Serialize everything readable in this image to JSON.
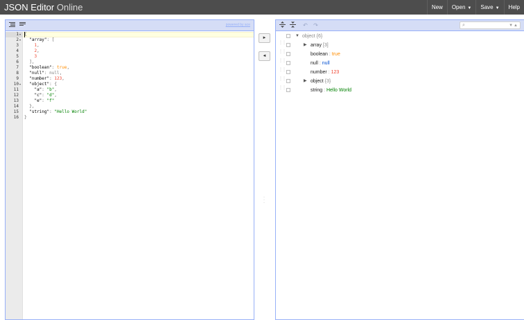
{
  "header": {
    "logo_bold": "JSON Editor",
    "logo_light": "Online",
    "menu": [
      {
        "label": "New",
        "has_caret": false
      },
      {
        "label": "Open",
        "has_caret": true
      },
      {
        "label": "Save",
        "has_caret": true
      },
      {
        "label": "Help",
        "has_caret": false
      }
    ]
  },
  "code_editor": {
    "powered_by": "powered by ace",
    "toolbar_buttons": [
      "format-icon",
      "compact-icon"
    ],
    "line_numbers": [
      "1",
      "2",
      "3",
      "4",
      "5",
      "6",
      "7",
      "8",
      "9",
      "10",
      "11",
      "12",
      "13",
      "14",
      "15",
      "16"
    ],
    "folds": [
      "1",
      "2",
      "10"
    ]
  },
  "tree_editor": {
    "toolbar_buttons": [
      "expand-all-icon",
      "collapse-all-icon",
      "undo-icon",
      "redo-icon"
    ],
    "root": {
      "type": "object",
      "count": "{6}"
    },
    "rows": [
      {
        "key": "array",
        "kind": "collapsed",
        "count": "[3]"
      },
      {
        "key": "boolean",
        "kind": "value",
        "value": "true",
        "vclass": "v-bool"
      },
      {
        "key": "null",
        "kind": "value",
        "value": "null",
        "vclass": "v-null"
      },
      {
        "key": "number",
        "kind": "value",
        "value": "123",
        "vclass": "v-num"
      },
      {
        "key": "object",
        "kind": "collapsed",
        "count": "{3}"
      },
      {
        "key": "string",
        "kind": "value",
        "value": "Hello World",
        "vclass": "v-str"
      }
    ],
    "separator": ":"
  },
  "colors": {
    "header_bg": "#4d4d4d",
    "panel_border": "#97b0f8",
    "toolbar_bg": "#d5ddf6"
  }
}
